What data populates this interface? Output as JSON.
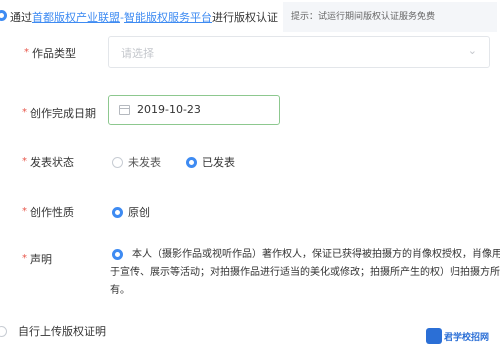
{
  "top_option": {
    "prefix": "通过",
    "link1": "首都版权产业联盟",
    "sep": "-",
    "link2": "智能版权服务平台",
    "suffix": "进行版权认证",
    "hint": "提示：试运行期间版权认证服务免费"
  },
  "form": {
    "work_type": {
      "label": "作品类型",
      "placeholder": "请选择"
    },
    "completion_date": {
      "label": "创作完成日期",
      "value": "2019-10-23"
    },
    "publish_status": {
      "label": "发表状态",
      "options": [
        "未发表",
        "已发表"
      ],
      "selected": "已发表"
    },
    "creation_nature": {
      "label": "创作性质",
      "options": [
        "原创"
      ],
      "selected": "原创"
    },
    "declaration": {
      "label": "声明",
      "text": "本人（摄影作品或视听作品）著作权人，保证已获得被拍摄方的肖像权授权，肖像用于宣传、展示等活动；对拍摄作品进行适当的美化或修改；拍摄所产生的权）归拍摄方所有。"
    }
  },
  "bottom_option": {
    "label": "自行上传版权证明"
  },
  "watermark": {
    "text": "君学校招网"
  },
  "colors": {
    "accent": "#3e8bf2",
    "required": "#e8564a",
    "date_border": "#8dc88f"
  }
}
